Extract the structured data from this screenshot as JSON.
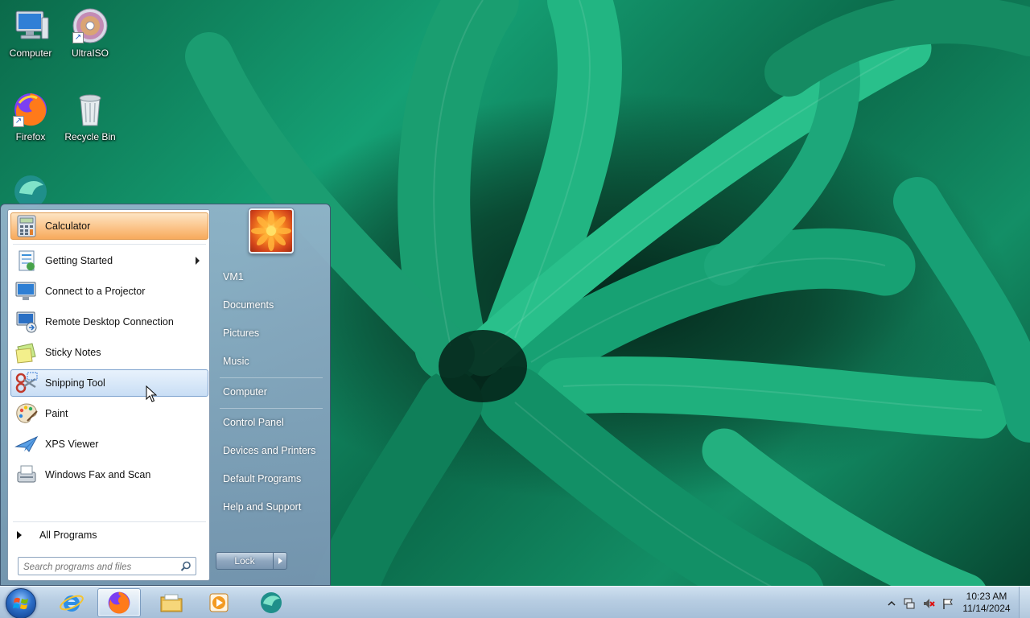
{
  "desktop": {
    "icons": [
      {
        "label": "Computer",
        "icon": "computer-icon"
      },
      {
        "label": "UltraISO",
        "icon": "disc-icon"
      },
      {
        "label": "Firefox",
        "icon": "firefox-icon"
      },
      {
        "label": "Recycle Bin",
        "icon": "recycle-bin-icon"
      },
      {
        "label": "",
        "icon": "app-icon"
      }
    ]
  },
  "start_menu": {
    "pinned": [
      {
        "label": "Calculator",
        "icon": "calculator-icon"
      }
    ],
    "recent": [
      {
        "label": "Getting Started",
        "icon": "getting-started-icon",
        "has_submenu": true
      },
      {
        "label": "Connect to a Projector",
        "icon": "projector-icon"
      },
      {
        "label": "Remote Desktop Connection",
        "icon": "remote-desktop-icon"
      },
      {
        "label": "Sticky Notes",
        "icon": "sticky-notes-icon"
      },
      {
        "label": "Snipping Tool",
        "icon": "scissors-icon",
        "hovered": true
      },
      {
        "label": "Paint",
        "icon": "paint-palette-icon"
      },
      {
        "label": "XPS Viewer",
        "icon": "xps-viewer-icon"
      },
      {
        "label": "Windows Fax and Scan",
        "icon": "fax-scanner-icon"
      }
    ],
    "all_programs_label": "All Programs",
    "search_placeholder": "Search programs and files",
    "right_pane": {
      "items": [
        "VM1",
        "Documents",
        "Pictures",
        "Music",
        "Computer",
        "Control Panel",
        "Devices and Printers",
        "Default Programs",
        "Help and Support"
      ]
    },
    "lock_label": "Lock"
  },
  "taskbar": {
    "buttons": [
      {
        "icon": "internet-explorer-icon"
      },
      {
        "icon": "firefox-icon",
        "active": true
      },
      {
        "icon": "file-explorer-icon"
      },
      {
        "icon": "media-player-icon"
      },
      {
        "icon": "app-icon"
      }
    ],
    "clock": {
      "time": "10:23 AM",
      "date": "11/14/2024"
    }
  },
  "colors": {
    "pinned_highlight": "#fbc48a",
    "hover_highlight": "#c9def5",
    "taskbar": "#b7cde2",
    "start_menu_frame": "#7896b2"
  }
}
